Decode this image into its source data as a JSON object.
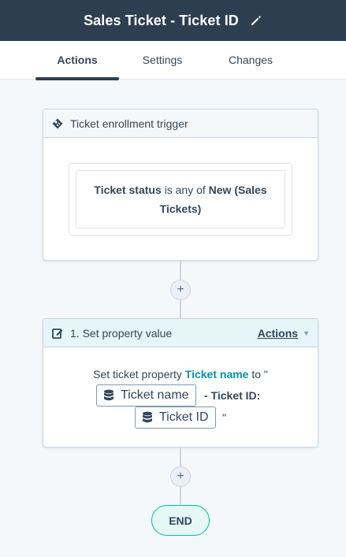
{
  "header": {
    "title": "Sales Ticket - Ticket ID",
    "edit_icon": "pencil-icon"
  },
  "tabs": [
    {
      "label": "Actions",
      "active": true
    },
    {
      "label": "Settings",
      "active": false
    },
    {
      "label": "Changes",
      "active": false
    }
  ],
  "trigger": {
    "title": "Ticket enrollment trigger",
    "icon": "ticket-icon",
    "condition": {
      "property": "Ticket status",
      "operator": "is any of",
      "value": "New (Sales Tickets)"
    }
  },
  "action": {
    "title": "1. Set property value",
    "icon": "edit-icon",
    "menu_label": "Actions",
    "text_prefix": "Set ticket property",
    "property_link": "Ticket name",
    "text_to": "to \"",
    "token1": "Ticket name",
    "separator": "- Ticket ID:",
    "token2": "Ticket ID",
    "closing_quote": "\""
  },
  "plus_label": "+",
  "end_label": "END",
  "colors": {
    "header_bg": "#2d3e50",
    "link": "#0091ae",
    "end_border": "#00bda5"
  }
}
